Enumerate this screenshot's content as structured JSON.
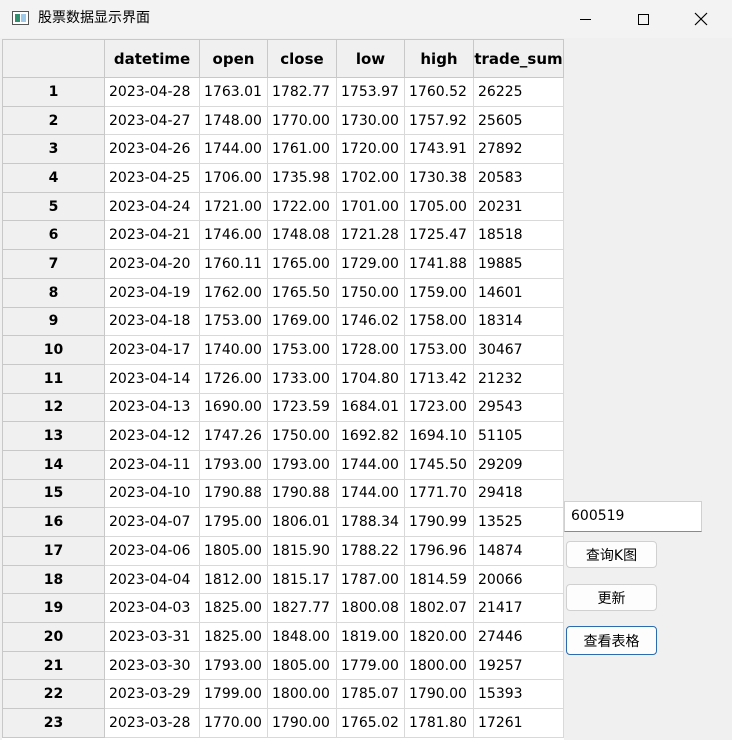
{
  "window": {
    "title": "股票数据显示界面",
    "controls": {
      "minimize": "minimize",
      "maximize": "maximize",
      "close": "close"
    }
  },
  "table": {
    "columns": [
      "datetime",
      "open",
      "close",
      "low",
      "high",
      "trade_sum"
    ],
    "rows": [
      {
        "index": "1",
        "cells": [
          "2023-04-28",
          "1763.01",
          "1782.77",
          "1753.97",
          "1760.52",
          "26225"
        ]
      },
      {
        "index": "2",
        "cells": [
          "2023-04-27",
          "1748.00",
          "1770.00",
          "1730.00",
          "1757.92",
          "25605"
        ]
      },
      {
        "index": "3",
        "cells": [
          "2023-04-26",
          "1744.00",
          "1761.00",
          "1720.00",
          "1743.91",
          "27892"
        ]
      },
      {
        "index": "4",
        "cells": [
          "2023-04-25",
          "1706.00",
          "1735.98",
          "1702.00",
          "1730.38",
          "20583"
        ]
      },
      {
        "index": "5",
        "cells": [
          "2023-04-24",
          "1721.00",
          "1722.00",
          "1701.00",
          "1705.00",
          "20231"
        ]
      },
      {
        "index": "6",
        "cells": [
          "2023-04-21",
          "1746.00",
          "1748.08",
          "1721.28",
          "1725.47",
          "18518"
        ]
      },
      {
        "index": "7",
        "cells": [
          "2023-04-20",
          "1760.11",
          "1765.00",
          "1729.00",
          "1741.88",
          "19885"
        ]
      },
      {
        "index": "8",
        "cells": [
          "2023-04-19",
          "1762.00",
          "1765.50",
          "1750.00",
          "1759.00",
          "14601"
        ]
      },
      {
        "index": "9",
        "cells": [
          "2023-04-18",
          "1753.00",
          "1769.00",
          "1746.02",
          "1758.00",
          "18314"
        ]
      },
      {
        "index": "10",
        "cells": [
          "2023-04-17",
          "1740.00",
          "1753.00",
          "1728.00",
          "1753.00",
          "30467"
        ]
      },
      {
        "index": "11",
        "cells": [
          "2023-04-14",
          "1726.00",
          "1733.00",
          "1704.80",
          "1713.42",
          "21232"
        ]
      },
      {
        "index": "12",
        "cells": [
          "2023-04-13",
          "1690.00",
          "1723.59",
          "1684.01",
          "1723.00",
          "29543"
        ]
      },
      {
        "index": "13",
        "cells": [
          "2023-04-12",
          "1747.26",
          "1750.00",
          "1692.82",
          "1694.10",
          "51105"
        ]
      },
      {
        "index": "14",
        "cells": [
          "2023-04-11",
          "1793.00",
          "1793.00",
          "1744.00",
          "1745.50",
          "29209"
        ]
      },
      {
        "index": "15",
        "cells": [
          "2023-04-10",
          "1790.88",
          "1790.88",
          "1744.00",
          "1771.70",
          "29418"
        ]
      },
      {
        "index": "16",
        "cells": [
          "2023-04-07",
          "1795.00",
          "1806.01",
          "1788.34",
          "1790.99",
          "13525"
        ]
      },
      {
        "index": "17",
        "cells": [
          "2023-04-06",
          "1805.00",
          "1815.90",
          "1788.22",
          "1796.96",
          "14874"
        ]
      },
      {
        "index": "18",
        "cells": [
          "2023-04-04",
          "1812.00",
          "1815.17",
          "1787.00",
          "1814.59",
          "20066"
        ]
      },
      {
        "index": "19",
        "cells": [
          "2023-04-03",
          "1825.00",
          "1827.77",
          "1800.08",
          "1802.07",
          "21417"
        ]
      },
      {
        "index": "20",
        "cells": [
          "2023-03-31",
          "1825.00",
          "1848.00",
          "1819.00",
          "1820.00",
          "27446"
        ]
      },
      {
        "index": "21",
        "cells": [
          "2023-03-30",
          "1793.00",
          "1805.00",
          "1779.00",
          "1800.00",
          "19257"
        ]
      },
      {
        "index": "22",
        "cells": [
          "2023-03-29",
          "1799.00",
          "1800.00",
          "1785.07",
          "1790.00",
          "15393"
        ]
      },
      {
        "index": "23",
        "cells": [
          "2023-03-28",
          "1770.00",
          "1790.00",
          "1765.02",
          "1781.80",
          "17261"
        ]
      }
    ]
  },
  "side_panel": {
    "stock_code_value": "600519",
    "kline_button": "查询K图",
    "update_button": "更新",
    "view_table_button": "查看表格"
  }
}
